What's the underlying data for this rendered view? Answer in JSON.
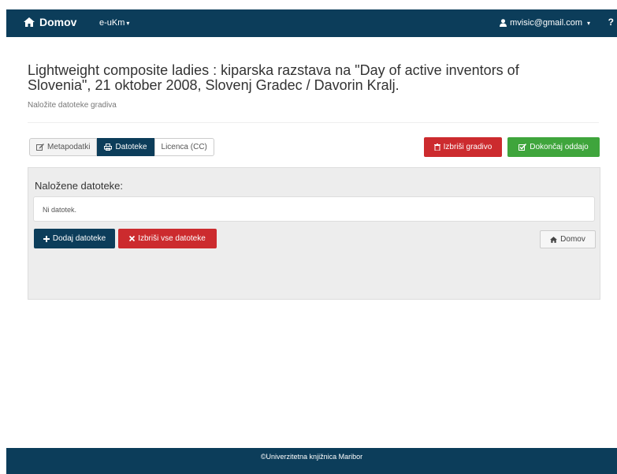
{
  "navbar": {
    "brand_label": "Domov",
    "brand_icon": "home-icon",
    "menu_label": "e-uKm",
    "user_email": "mvisic@gmail.com",
    "help_label": "?"
  },
  "page": {
    "title": "Lightweight composite ladies : kiparska razstava na \"Day of active inventors of Slovenia\", 21 oktober 2008, Slovenj Gradec / Davorin Kralj.",
    "subtitle": "Naložite datoteke gradiva"
  },
  "tabs": [
    {
      "label": "Metapodatki",
      "icon": "edit-icon",
      "active": false
    },
    {
      "label": "Datoteke",
      "icon": "print-icon",
      "active": true
    },
    {
      "label": "Licenca (CC)",
      "icon": "",
      "active": false
    }
  ],
  "actions": {
    "delete_gradivo_label": "Izbriši gradivo",
    "finish_label": "Dokončaj oddajo"
  },
  "files_panel": {
    "title": "Naložene datoteke:",
    "empty_text": "Ni datotek.",
    "add_label": "Dodaj datoteke",
    "delete_all_label": "Izbriši vse datoteke",
    "home_label": "Domov"
  },
  "footer": {
    "text": "©Univerzitetna knjižnica Maribor"
  },
  "colors": {
    "navbar": "#0c3d5a",
    "danger": "#cc2b2e",
    "success": "#3fa53c"
  }
}
